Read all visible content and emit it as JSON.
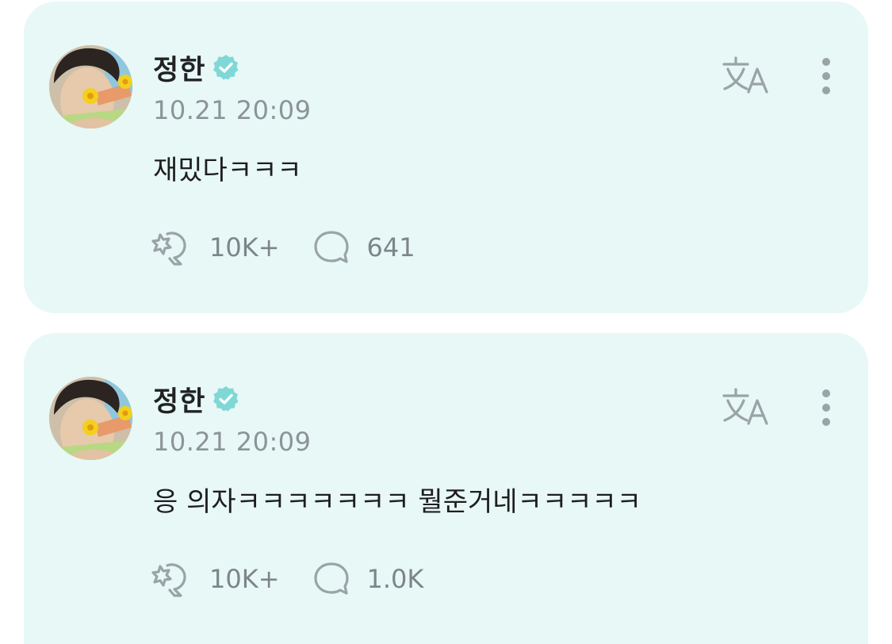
{
  "colors": {
    "card_background": "#e7f8f6",
    "verified_badge": "#7fd8d6",
    "icon_gray": "#9aa3a6",
    "timestamp_gray": "#8c9498"
  },
  "posts": [
    {
      "author": "정한",
      "verified_icon": "verified-badge-icon",
      "timestamp": "10.21 20:09",
      "text": "재밌다ㅋㅋㅋ",
      "likes": "10K+",
      "comments": "641"
    },
    {
      "author": "정한",
      "verified_icon": "verified-badge-icon",
      "timestamp": "10.21 20:09",
      "text": "응 의자ㅋㅋㅋㅋㅋㅋㅋ 뭘준거네ㅋㅋㅋㅋㅋ",
      "likes": "10K+",
      "comments": "1.0K"
    }
  ]
}
